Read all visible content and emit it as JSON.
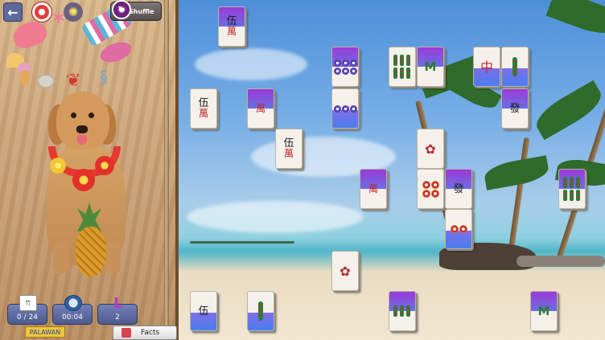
{
  "toolbar": {
    "back_label": "←",
    "shuffle_label": "Shuffle",
    "shuffle_icon_glyph": "↻"
  },
  "stats": {
    "matched": "0 / 24",
    "time": "00:04",
    "level": "2",
    "level_icon_glyph": "L",
    "tile_icon_glyph": "竹"
  },
  "location_label": "PALAWAN",
  "facts_label": "Facts",
  "colors": {
    "tile_face": "#f5f1ea",
    "tile_highlight": "#9b3ad8",
    "panel_button": "#5d6a9b",
    "label_yellow": "#f1c43d"
  },
  "tiles": [
    {
      "id": "t1",
      "face": "伍萬",
      "kind": "character",
      "highlight": "half"
    },
    {
      "id": "t2",
      "face": "伍萬",
      "kind": "character",
      "highlight": "none"
    },
    {
      "id": "t3",
      "face": "萬",
      "kind": "character",
      "highlight": "half"
    },
    {
      "id": "t4",
      "face": "伍萬",
      "kind": "character",
      "highlight": "none"
    },
    {
      "id": "t5",
      "face": "6 circles",
      "kind": "dots",
      "highlight": "half"
    },
    {
      "id": "t6",
      "face": "3 circles",
      "kind": "dots",
      "highlight": "bottom"
    },
    {
      "id": "t7",
      "face": "6 bamboo",
      "kind": "bamboo",
      "highlight": "none"
    },
    {
      "id": "t8",
      "face": "M bamboo",
      "kind": "bamboo",
      "highlight": "half"
    },
    {
      "id": "t9",
      "face": "中",
      "kind": "dragon",
      "highlight": "bottom"
    },
    {
      "id": "t10",
      "face": "1 bamboo",
      "kind": "bamboo",
      "highlight": "bottom"
    },
    {
      "id": "t11",
      "face": "發",
      "kind": "dragon",
      "highlight": "half"
    },
    {
      "id": "t12",
      "face": "flower",
      "kind": "flower",
      "highlight": "none"
    },
    {
      "id": "t13",
      "face": "萬",
      "kind": "character",
      "highlight": "half"
    },
    {
      "id": "t14",
      "face": "red circles",
      "kind": "dots",
      "highlight": "none"
    },
    {
      "id": "t15",
      "face": "發",
      "kind": "dragon",
      "highlight": "half"
    },
    {
      "id": "t16",
      "face": "2 circles",
      "kind": "dots",
      "highlight": "bottom"
    },
    {
      "id": "t17",
      "face": "6 bamboo",
      "kind": "bamboo",
      "highlight": "half"
    },
    {
      "id": "t18",
      "face": "flower",
      "kind": "flower",
      "highlight": "none"
    },
    {
      "id": "t19",
      "face": "伍萬",
      "kind": "character",
      "highlight": "bottom"
    },
    {
      "id": "t20",
      "face": "1 bamboo",
      "kind": "bamboo",
      "highlight": "bottom"
    },
    {
      "id": "t21",
      "face": "6 bamboo",
      "kind": "bamboo",
      "highlight": "half"
    },
    {
      "id": "t22",
      "face": "M bamboo",
      "kind": "bamboo",
      "highlight": "half"
    },
    {
      "id": "t23",
      "face": "伍萬",
      "kind": "character",
      "highlight": "bottom"
    }
  ]
}
